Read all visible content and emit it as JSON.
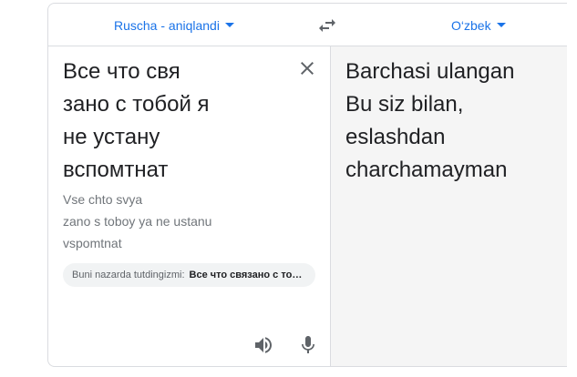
{
  "header": {
    "source_language": "Ruscha - aniqlandi",
    "target_language": "O‘zbek"
  },
  "source": {
    "text": "Все что свя\nзано с тобой я\nне устану\nвспомтнат",
    "transliteration": "Vse chto svya\nzano s toboy ya ne ustanu\nvspomtnat",
    "suggestion_label": "Buni nazarda tutdingizmi:",
    "suggestion_text": "Все что связано с тобой я не устану вспомнить"
  },
  "target": {
    "text": "Barchasi ulangan\nBu siz bilan,\neslashdan\ncharchamayman"
  },
  "icons": {
    "swap": "swap-languages-icon",
    "clear": "close-icon",
    "listen": "speaker-icon",
    "mic": "microphone-icon"
  },
  "colors": {
    "accent": "#1a73e8",
    "text": "#202124",
    "muted": "#70757a",
    "icon": "#5f6368",
    "target_bg": "#f5f5f5"
  }
}
